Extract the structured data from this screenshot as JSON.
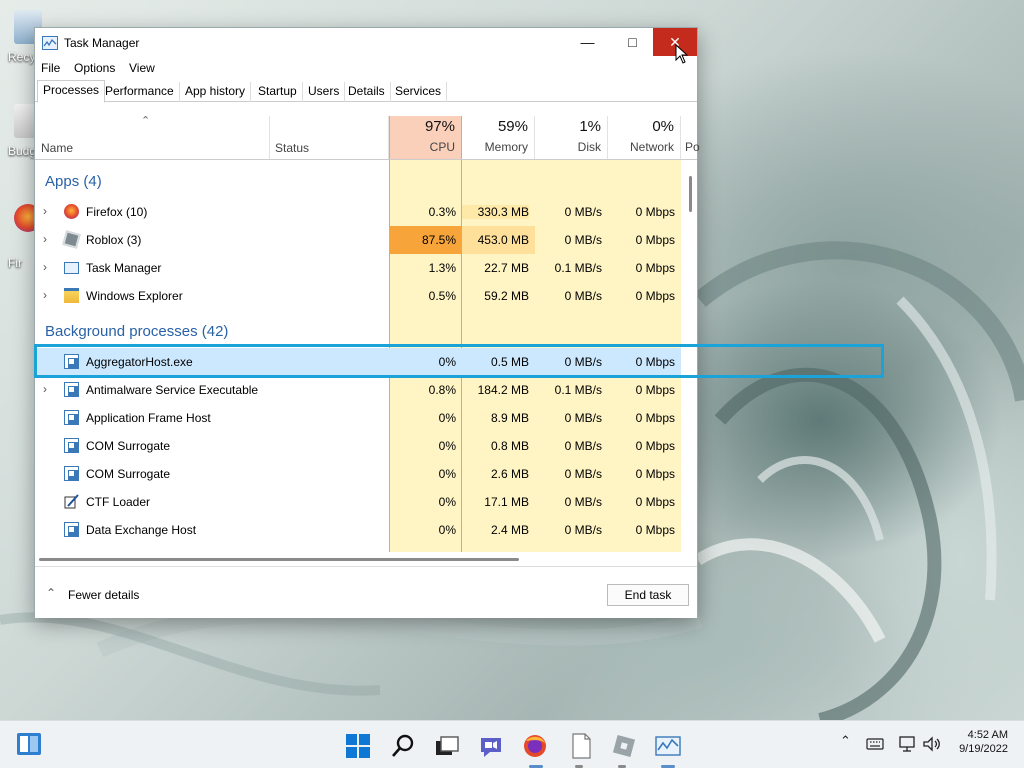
{
  "desktop": {
    "icons": [
      {
        "label": "Recy"
      },
      {
        "label": "Budg"
      },
      {
        "label": "Fir"
      }
    ]
  },
  "window": {
    "title": "Task Manager",
    "menu": [
      "File",
      "Options",
      "View"
    ],
    "tabs": [
      "Processes",
      "Performance",
      "App history",
      "Startup",
      "Users",
      "Details",
      "Services"
    ],
    "active_tab": "Processes",
    "columns": {
      "name": "Name",
      "status": "Status",
      "cpu": {
        "pct": "97%",
        "label": "CPU"
      },
      "memory": {
        "pct": "59%",
        "label": "Memory"
      },
      "disk": {
        "pct": "1%",
        "label": "Disk"
      },
      "network": {
        "pct": "0%",
        "label": "Network"
      },
      "power": "Po"
    },
    "groups": {
      "apps": "Apps (4)",
      "background": "Background processes (42)"
    },
    "apps": [
      {
        "name": "Firefox (10)",
        "cpu": "0.3%",
        "memory": "330.3 MB",
        "disk": "0 MB/s",
        "network": "0 Mbps"
      },
      {
        "name": "Roblox (3)",
        "cpu": "87.5%",
        "memory": "453.0 MB",
        "disk": "0 MB/s",
        "network": "0 Mbps"
      },
      {
        "name": "Task Manager",
        "cpu": "1.3%",
        "memory": "22.7 MB",
        "disk": "0.1 MB/s",
        "network": "0 Mbps"
      },
      {
        "name": "Windows Explorer",
        "cpu": "0.5%",
        "memory": "59.2 MB",
        "disk": "0 MB/s",
        "network": "0 Mbps"
      }
    ],
    "background": [
      {
        "name": "AggregatorHost.exe",
        "cpu": "0%",
        "memory": "0.5 MB",
        "disk": "0 MB/s",
        "network": "0 Mbps"
      },
      {
        "name": "Antimalware Service Executable",
        "cpu": "0.8%",
        "memory": "184.2 MB",
        "disk": "0.1 MB/s",
        "network": "0 Mbps"
      },
      {
        "name": "Application Frame Host",
        "cpu": "0%",
        "memory": "8.9 MB",
        "disk": "0 MB/s",
        "network": "0 Mbps"
      },
      {
        "name": "COM Surrogate",
        "cpu": "0%",
        "memory": "0.8 MB",
        "disk": "0 MB/s",
        "network": "0 Mbps"
      },
      {
        "name": "COM Surrogate",
        "cpu": "0%",
        "memory": "2.6 MB",
        "disk": "0 MB/s",
        "network": "0 Mbps"
      },
      {
        "name": "CTF Loader",
        "cpu": "0%",
        "memory": "17.1 MB",
        "disk": "0 MB/s",
        "network": "0 Mbps"
      },
      {
        "name": "Data Exchange Host",
        "cpu": "0%",
        "memory": "2.4 MB",
        "disk": "0 MB/s",
        "network": "0 Mbps"
      }
    ],
    "footer": {
      "fewer_details": "Fewer details",
      "end_task": "End task"
    }
  },
  "taskbar": {
    "time": "4:52 AM",
    "date": "9/19/2022"
  },
  "colors": {
    "cpu_header": "#fbd0bb",
    "cpu_hot": "#f7a43a",
    "col_tint": "#fff4c4",
    "col_tint_mid": "#ffe9a8",
    "selected": "#cce8ff",
    "highlight": "#1aa3d9",
    "group": "#2a62a6",
    "close": "#c42b1c"
  }
}
